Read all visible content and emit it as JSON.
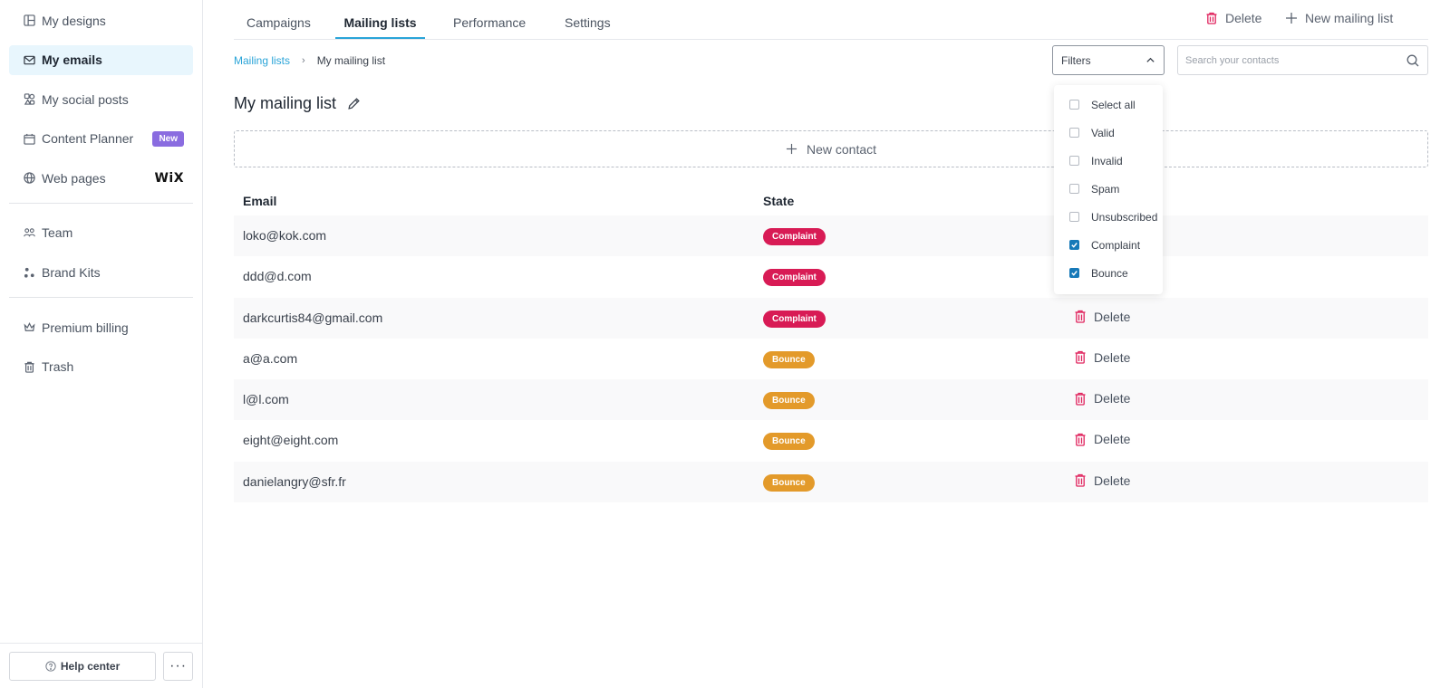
{
  "sidebar": {
    "items": [
      {
        "label": "My designs",
        "icon": "designs-icon"
      },
      {
        "label": "My emails",
        "icon": "mail-icon",
        "active": true
      },
      {
        "label": "My social posts",
        "icon": "social-posts-icon"
      },
      {
        "label": "Content Planner",
        "icon": "calendar-icon",
        "badge": "New"
      },
      {
        "label": "Web pages",
        "icon": "web-icon",
        "brand": "WiX"
      }
    ],
    "items2": [
      {
        "label": "Team",
        "icon": "team-icon"
      },
      {
        "label": "Brand Kits",
        "icon": "brand-kit-icon"
      }
    ],
    "items3": [
      {
        "label": "Premium billing",
        "icon": "crown-icon"
      },
      {
        "label": "Trash",
        "icon": "trash-icon"
      }
    ],
    "help_label": "Help center",
    "more_label": "···"
  },
  "tabs": [
    {
      "label": "Campaigns"
    },
    {
      "label": "Mailing lists",
      "active": true
    },
    {
      "label": "Performance"
    },
    {
      "label": "Settings"
    }
  ],
  "top_actions": {
    "delete_label": "Delete",
    "new_list_label": "New mailing list"
  },
  "breadcrumb": {
    "parent": "Mailing lists",
    "separator": "›",
    "current": "My mailing list"
  },
  "filters": {
    "label": "Filters",
    "options": [
      {
        "label": "Select all",
        "checked": false
      },
      {
        "label": "Valid",
        "checked": false
      },
      {
        "label": "Invalid",
        "checked": false
      },
      {
        "label": "Spam",
        "checked": false
      },
      {
        "label": "Unsubscribed",
        "checked": false
      },
      {
        "label": "Complaint",
        "checked": true
      },
      {
        "label": "Bounce",
        "checked": true
      }
    ]
  },
  "search": {
    "placeholder": "Search your contacts"
  },
  "page": {
    "title": "My mailing list",
    "new_contact_label": "New contact"
  },
  "table": {
    "headers": {
      "email": "Email",
      "state": "State"
    },
    "delete_label": "Delete",
    "rows": [
      {
        "email": "loko@kok.com",
        "state": "Complaint"
      },
      {
        "email": "ddd@d.com",
        "state": "Complaint"
      },
      {
        "email": "darkcurtis84@gmail.com",
        "state": "Complaint"
      },
      {
        "email": "a@a.com",
        "state": "Bounce"
      },
      {
        "email": "l@l.com",
        "state": "Bounce"
      },
      {
        "email": "eight@eight.com",
        "state": "Bounce"
      },
      {
        "email": "danielangry@sfr.fr",
        "state": "Bounce"
      }
    ]
  },
  "colors": {
    "accent": "#2aa4d8",
    "complaint": "#d81b55",
    "bounce": "#e39a2a",
    "delete_icon": "#e0245e",
    "badge_new": "#8a6ce0",
    "checkbox": "#1779b8"
  }
}
